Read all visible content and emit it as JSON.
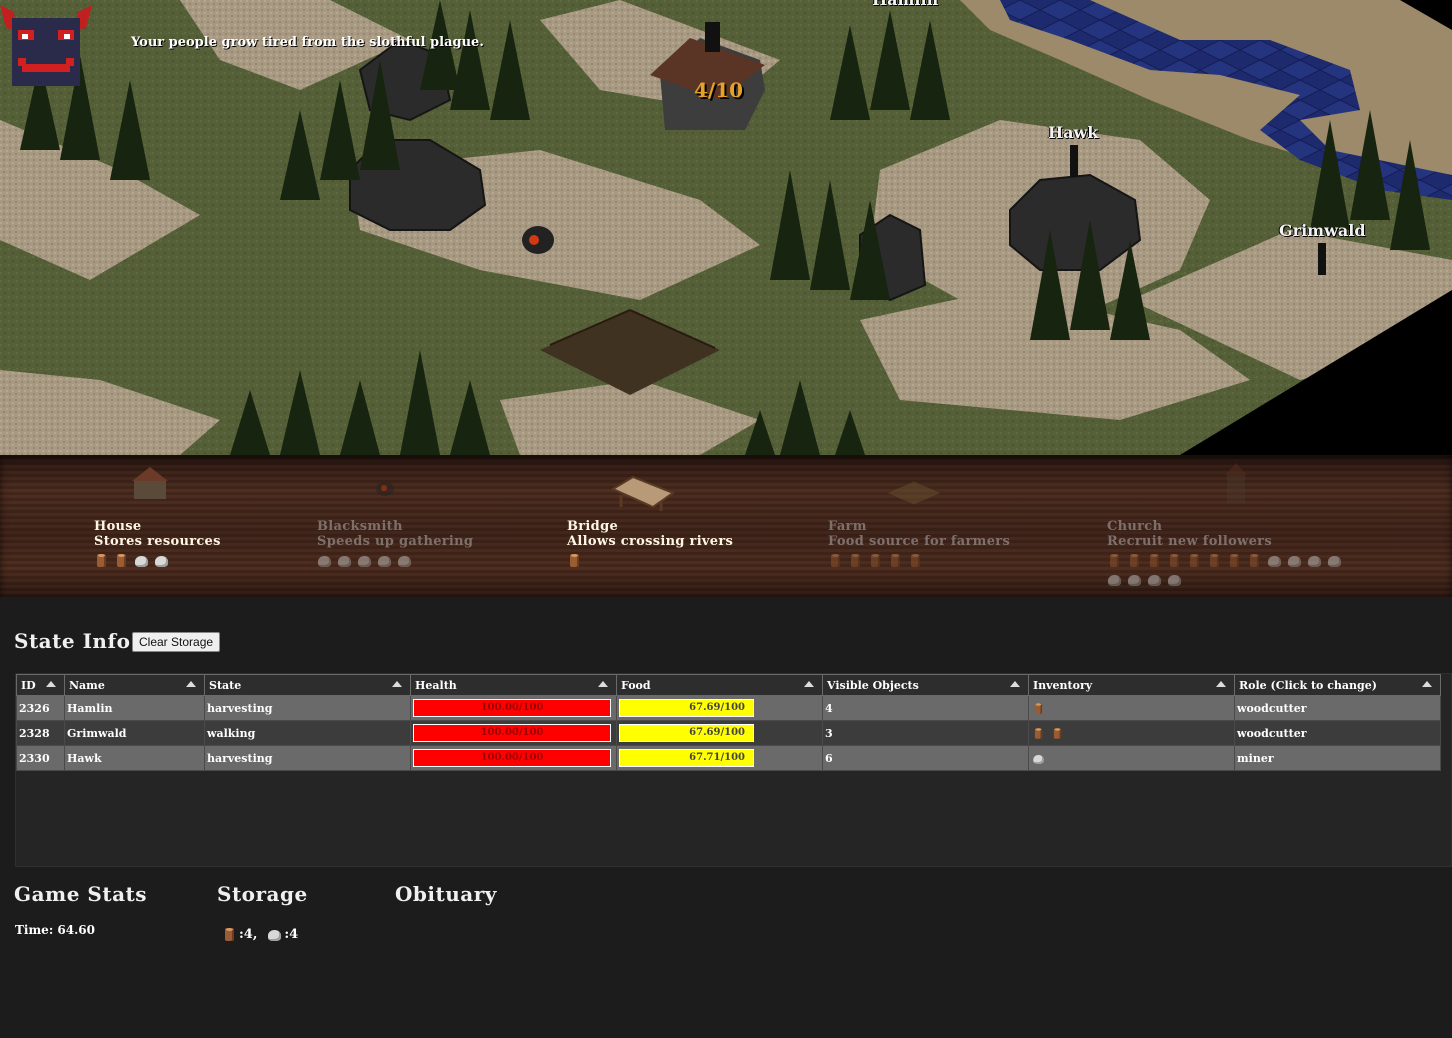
{
  "map": {
    "plague_message": "Your people grow tired from the slothful plague.",
    "house_counter": "4/10",
    "units": [
      {
        "name": "Hamlin"
      },
      {
        "name": "Hawk"
      },
      {
        "name": "Grimwald"
      }
    ]
  },
  "build_menu": [
    {
      "title": "House",
      "desc": "Stores resources",
      "available": true,
      "cost": [
        "wood",
        "wood",
        "stone",
        "stone"
      ]
    },
    {
      "title": "Blacksmith",
      "desc": "Speeds up gathering",
      "available": false,
      "cost": [
        "stone",
        "stone",
        "stone",
        "stone",
        "stone"
      ]
    },
    {
      "title": "Bridge",
      "desc": "Allows crossing rivers",
      "available": true,
      "cost": [
        "wood"
      ]
    },
    {
      "title": "Farm",
      "desc": "Food source for farmers",
      "available": false,
      "cost": [
        "wood",
        "wood",
        "wood",
        "wood",
        "wood"
      ]
    },
    {
      "title": "Church",
      "desc": "Recruit new followers",
      "available": false,
      "cost": [
        "wood",
        "wood",
        "wood",
        "wood",
        "wood",
        "wood",
        "wood",
        "wood",
        "stone",
        "stone",
        "stone",
        "stone",
        "stone",
        "stone",
        "stone",
        "stone"
      ]
    }
  ],
  "state_info": {
    "title": "State Info",
    "clear_storage_label": "Clear Storage",
    "columns": [
      "ID",
      "Name",
      "State",
      "Health",
      "Food",
      "Visible Objects",
      "Inventory",
      "Role (Click to change)"
    ],
    "rows": [
      {
        "id": "2326",
        "name": "Hamlin",
        "state": "harvesting",
        "health": "100.00/100",
        "food": "67.69/100",
        "visible": "4",
        "inventory": [
          "wood"
        ],
        "role": "woodcutter"
      },
      {
        "id": "2328",
        "name": "Grimwald",
        "state": "walking",
        "health": "100.00/100",
        "food": "67.69/100",
        "visible": "3",
        "inventory": [
          "wood",
          "wood"
        ],
        "role": "woodcutter"
      },
      {
        "id": "2330",
        "name": "Hawk",
        "state": "harvesting",
        "health": "100.00/100",
        "food": "67.71/100",
        "visible": "6",
        "inventory": [
          "stone"
        ],
        "role": "miner"
      }
    ]
  },
  "game_stats": {
    "title": "Game Stats",
    "time": "Time: 64.60"
  },
  "storage": {
    "title": "Storage",
    "wood": ":4,",
    "stone": ":4"
  },
  "obituary": {
    "title": "Obituary"
  }
}
